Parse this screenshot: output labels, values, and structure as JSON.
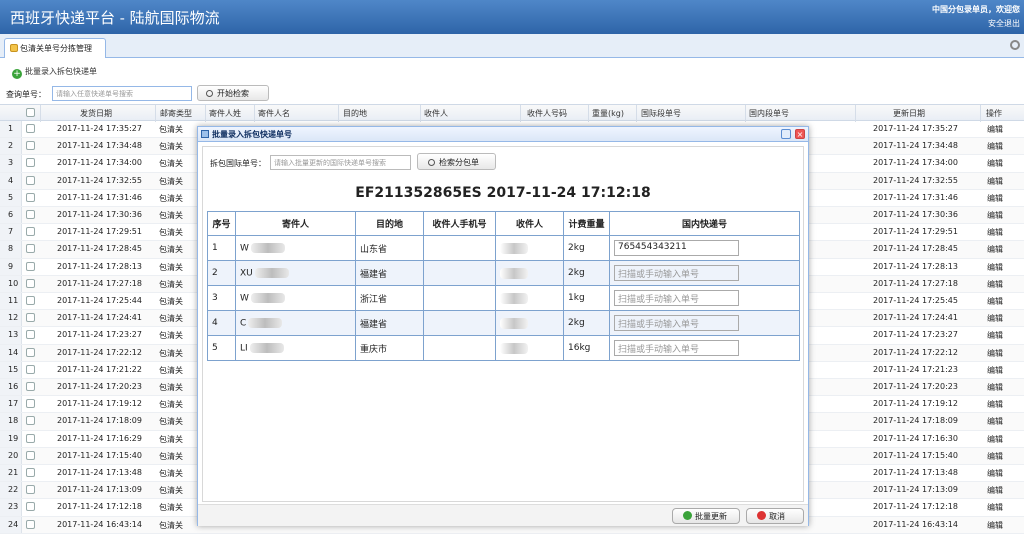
{
  "app": {
    "title": "西班牙快递平台 - 陆航国际物流",
    "user_text": "中国分包录单员，欢迎您",
    "safe_exit": "安全退出"
  },
  "tab": {
    "label": "包清关单号分拣管理"
  },
  "toolbar": {
    "batch_label": "批量录入拆包快递单"
  },
  "search": {
    "label": "查询单号：",
    "placeholder": "请输入任意快递单号搜索",
    "button": "开始检索"
  },
  "grid": {
    "headers": [
      "发货日期",
      "邮寄类型",
      "寄件人姓",
      "寄件人名",
      "目的地",
      "收件人",
      "收件人号码",
      "重量(kg)",
      "国际段单号",
      "国内段单号",
      "更新日期",
      "操作"
    ],
    "rows": [
      {
        "n": "1",
        "date": "2017-11-24 17:35:27",
        "type": "包清关",
        "upd": "2017-11-24 17:35:27",
        "op": "编辑"
      },
      {
        "n": "2",
        "date": "2017-11-24 17:34:48",
        "type": "包清关",
        "upd": "2017-11-24 17:34:48",
        "op": "编辑"
      },
      {
        "n": "3",
        "date": "2017-11-24 17:34:00",
        "type": "包清关",
        "upd": "2017-11-24 17:34:00",
        "op": "编辑"
      },
      {
        "n": "4",
        "date": "2017-11-24 17:32:55",
        "type": "包清关",
        "upd": "2017-11-24 17:32:55",
        "op": "编辑"
      },
      {
        "n": "5",
        "date": "2017-11-24 17:31:46",
        "type": "包清关",
        "upd": "2017-11-24 17:31:46",
        "op": "编辑"
      },
      {
        "n": "6",
        "date": "2017-11-24 17:30:36",
        "type": "包清关",
        "upd": "2017-11-24 17:30:36",
        "op": "编辑"
      },
      {
        "n": "7",
        "date": "2017-11-24 17:29:51",
        "type": "包清关",
        "upd": "2017-11-24 17:29:51",
        "op": "编辑"
      },
      {
        "n": "8",
        "date": "2017-11-24 17:28:45",
        "type": "包清关",
        "upd": "2017-11-24 17:28:45",
        "op": "编辑"
      },
      {
        "n": "9",
        "date": "2017-11-24 17:28:13",
        "type": "包清关",
        "upd": "2017-11-24 17:28:13",
        "op": "编辑"
      },
      {
        "n": "10",
        "date": "2017-11-24 17:27:18",
        "type": "包清关",
        "upd": "2017-11-24 17:27:18",
        "op": "编辑"
      },
      {
        "n": "11",
        "date": "2017-11-24 17:25:44",
        "type": "包清关",
        "upd": "2017-11-24 17:25:45",
        "op": "编辑"
      },
      {
        "n": "12",
        "date": "2017-11-24 17:24:41",
        "type": "包清关",
        "upd": "2017-11-24 17:24:41",
        "op": "编辑"
      },
      {
        "n": "13",
        "date": "2017-11-24 17:23:27",
        "type": "包清关",
        "upd": "2017-11-24 17:23:27",
        "op": "编辑"
      },
      {
        "n": "14",
        "date": "2017-11-24 17:22:12",
        "type": "包清关",
        "upd": "2017-11-24 17:22:12",
        "op": "编辑"
      },
      {
        "n": "15",
        "date": "2017-11-24 17:21:22",
        "type": "包清关",
        "upd": "2017-11-24 17:21:23",
        "op": "编辑"
      },
      {
        "n": "16",
        "date": "2017-11-24 17:20:23",
        "type": "包清关",
        "upd": "2017-11-24 17:20:23",
        "op": "编辑"
      },
      {
        "n": "17",
        "date": "2017-11-24 17:19:12",
        "type": "包清关",
        "upd": "2017-11-24 17:19:12",
        "op": "编辑"
      },
      {
        "n": "18",
        "date": "2017-11-24 17:18:09",
        "type": "包清关",
        "upd": "2017-11-24 17:18:09",
        "op": "编辑"
      },
      {
        "n": "19",
        "date": "2017-11-24 17:16:29",
        "type": "包清关",
        "upd": "2017-11-24 17:16:30",
        "op": "编辑"
      },
      {
        "n": "20",
        "date": "2017-11-24 17:15:40",
        "type": "包清关",
        "upd": "2017-11-24 17:15:40",
        "op": "编辑"
      },
      {
        "n": "21",
        "date": "2017-11-24 17:13:48",
        "type": "包清关",
        "upd": "2017-11-24 17:13:48",
        "op": "编辑"
      },
      {
        "n": "22",
        "date": "2017-11-24 17:13:09",
        "type": "包清关",
        "upd": "2017-11-24 17:13:09",
        "op": "编辑"
      },
      {
        "n": "23",
        "date": "2017-11-24 17:12:18",
        "type": "包清关",
        "upd": "2017-11-24 17:12:18",
        "op": "编辑"
      },
      {
        "n": "24",
        "date": "2017-11-24 16:43:14",
        "type": "包清关",
        "upd": "2017-11-24 16:43:14",
        "op": "编辑"
      }
    ]
  },
  "dialog": {
    "title": "批量录入拆包快递单号",
    "scan_label": "拆包国际单号：",
    "scan_placeholder": "请输入批量更新的国际快递单号搜索",
    "scan_button": "检索分包单",
    "order_title": "EF211352865ES 2017-11-24 17:12:18",
    "columns": [
      "序号",
      "寄件人",
      "目的地",
      "收件人手机号",
      "收件人",
      "计费重量",
      "国内快递号"
    ],
    "items": [
      {
        "no": "1",
        "sender": "W",
        "dest": "山东省",
        "weight": "2kg",
        "express": "765454343211"
      },
      {
        "no": "2",
        "sender": "XU",
        "dest": "福建省",
        "weight": "2kg",
        "express": ""
      },
      {
        "no": "3",
        "sender": "W",
        "dest": "浙江省",
        "weight": "1kg",
        "express": ""
      },
      {
        "no": "4",
        "sender": "C",
        "dest": "福建省",
        "weight": "2kg",
        "express": ""
      },
      {
        "no": "5",
        "sender": "LI",
        "dest": "重庆市",
        "weight": "16kg",
        "express": ""
      }
    ],
    "express_placeholder": "扫描或手动输入单号",
    "update_button": "批量更新",
    "cancel_button": "取消"
  }
}
